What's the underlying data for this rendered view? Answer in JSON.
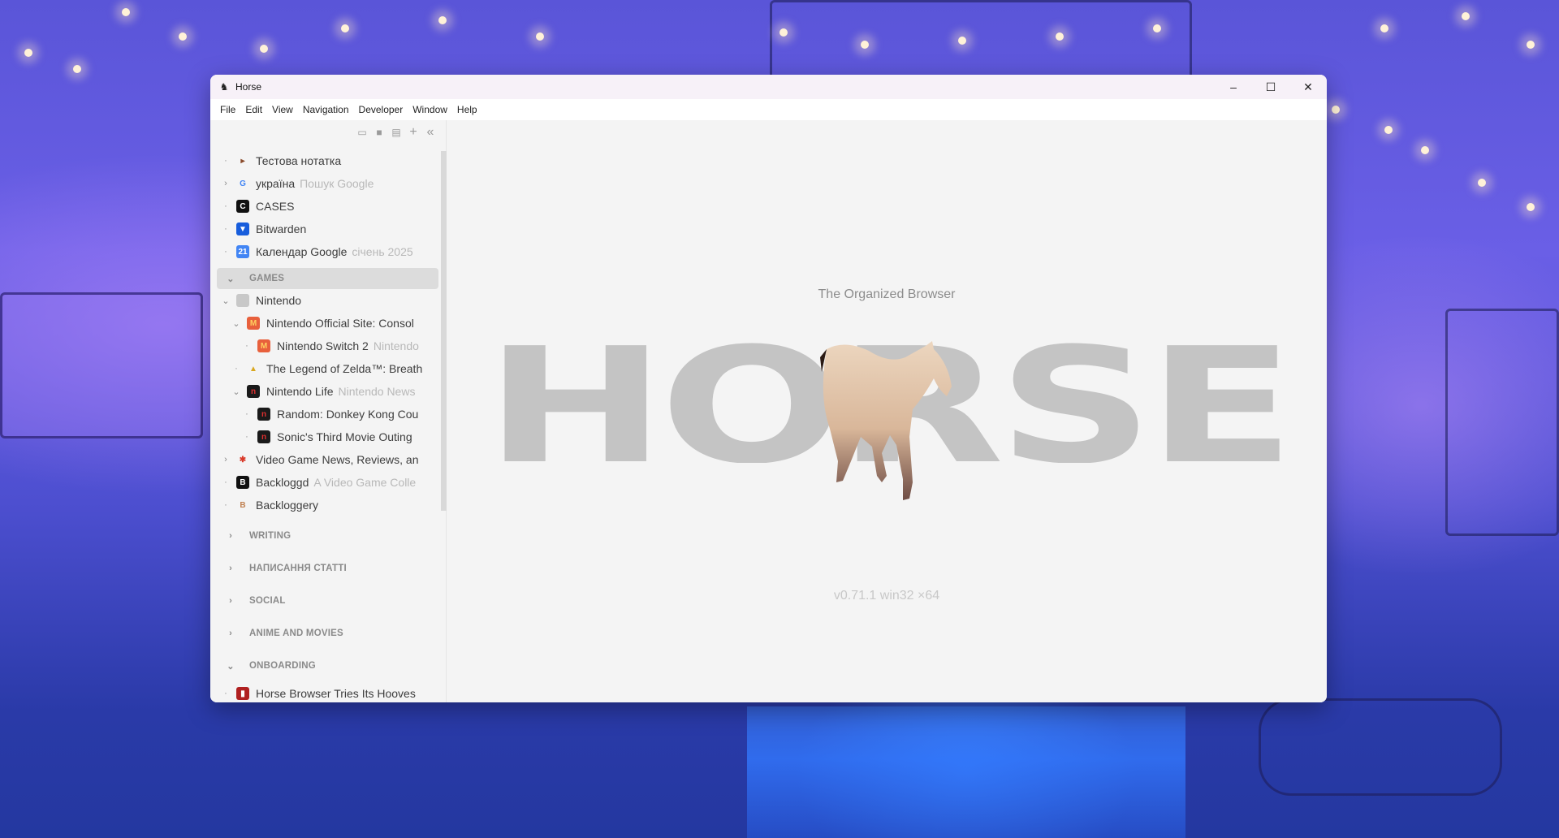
{
  "window": {
    "title": "Horse",
    "app_icon": "horse-icon",
    "controls": {
      "minimize": "–",
      "maximize": "☐",
      "close": "✕"
    }
  },
  "menu": [
    "File",
    "Edit",
    "View",
    "Navigation",
    "Developer",
    "Window",
    "Help"
  ],
  "sidebar": {
    "toolbar": [
      {
        "icon": "tag-icon",
        "glyph": "▭"
      },
      {
        "icon": "folder-icon",
        "glyph": "■"
      },
      {
        "icon": "note-icon",
        "glyph": "▤"
      },
      {
        "icon": "add-icon",
        "glyph": "+"
      },
      {
        "icon": "collapse-sidebar-icon",
        "glyph": "«"
      }
    ],
    "top_items": [
      {
        "label": "Тестова нотатка",
        "sub": "",
        "toggle": "·",
        "icon": "note-favicon",
        "color": "#f4f4f4",
        "glyph": "▸",
        "glyph_color": "#8a4a2a"
      },
      {
        "label": "україна",
        "sub": "Пошук Google",
        "toggle": "›",
        "icon": "google-favicon",
        "color": "#f4f4f4",
        "glyph": "G",
        "glyph_color": "#4285f4"
      },
      {
        "label": "CASES",
        "sub": "",
        "toggle": "·",
        "icon": "cases-favicon",
        "color": "#111111",
        "glyph": "C",
        "glyph_color": "#ffffff"
      },
      {
        "label": "Bitwarden",
        "sub": "",
        "toggle": "·",
        "icon": "bitwarden-favicon",
        "color": "#175ddc",
        "glyph": "▼",
        "glyph_color": "#ffffff"
      },
      {
        "label": "Календар Google",
        "sub": "січень 2025",
        "toggle": "·",
        "icon": "google-calendar-favicon",
        "color": "#4285f4",
        "glyph": "21",
        "glyph_color": "#ffffff"
      }
    ],
    "games_section": {
      "label": "GAMES",
      "expanded": true,
      "items": [
        {
          "label": "Nintendo",
          "sub": "",
          "toggle": "⌄",
          "level": 0,
          "icon": "folder-icon",
          "color": "#c8c8c8",
          "glyph": "",
          "glyph_color": "#fff"
        },
        {
          "label": "Nintendo Official Site: Consol",
          "sub": "",
          "toggle": "⌄",
          "level": 1,
          "icon": "mario-favicon",
          "color": "#e8603c",
          "glyph": "M",
          "glyph_color": "#ffd060"
        },
        {
          "label": "Nintendo Switch 2",
          "sub": "Nintendo",
          "toggle": "·",
          "level": 2,
          "icon": "mario-favicon",
          "color": "#e8603c",
          "glyph": "M",
          "glyph_color": "#ffd060"
        },
        {
          "label": "The Legend of Zelda™: Breath",
          "sub": "",
          "toggle": "·",
          "level": 1,
          "icon": "triforce-favicon",
          "color": "#f4f4f4",
          "glyph": "▲",
          "glyph_color": "#d9a820"
        },
        {
          "label": "Nintendo Life",
          "sub": "Nintendo News",
          "toggle": "⌄",
          "level": 1,
          "icon": "nintendolife-favicon",
          "color": "#1a1a1a",
          "glyph": "n",
          "glyph_color": "#e03030"
        },
        {
          "label": "Random: Donkey Kong Cou",
          "sub": "",
          "toggle": "·",
          "level": 2,
          "icon": "nintendolife-favicon",
          "color": "#1a1a1a",
          "glyph": "n",
          "glyph_color": "#e03030"
        },
        {
          "label": "Sonic's Third Movie Outing",
          "sub": "",
          "toggle": "·",
          "level": 2,
          "icon": "nintendolife-favicon",
          "color": "#1a1a1a",
          "glyph": "n",
          "glyph_color": "#e03030"
        },
        {
          "label": "Video Game News, Reviews, an",
          "sub": "",
          "toggle": "›",
          "level": 0,
          "icon": "ign-favicon",
          "color": "#f4f4f4",
          "glyph": "✱",
          "glyph_color": "#d93a2a"
        },
        {
          "label": "Backloggd",
          "sub": "A Video Game Colle",
          "toggle": "·",
          "level": 0,
          "icon": "backloggd-favicon",
          "color": "#111111",
          "glyph": "B",
          "glyph_color": "#ffffff"
        },
        {
          "label": "Backloggery",
          "sub": "",
          "toggle": "·",
          "level": 0,
          "icon": "backloggery-favicon",
          "color": "#f4f4f4",
          "glyph": "B",
          "glyph_color": "#c08050"
        }
      ]
    },
    "collapsed_sections": [
      "WRITING",
      "НАПИСАННЯ СТАТТІ",
      "SOCIAL",
      "ANIME AND MOVIES"
    ],
    "onboarding_section": {
      "label": "ONBOARDING",
      "expanded": true,
      "items": [
        {
          "label": "Horse Browser Tries Its Hooves",
          "sub": "",
          "toggle": "·",
          "icon": "bookmark-favicon",
          "color": "#b02020",
          "glyph": "▮",
          "glyph_color": "#ffffff"
        }
      ]
    }
  },
  "content": {
    "tagline": "The Organized Browser",
    "logo_text": "HORSE",
    "version": "v0.71.1 win32 ×64"
  }
}
